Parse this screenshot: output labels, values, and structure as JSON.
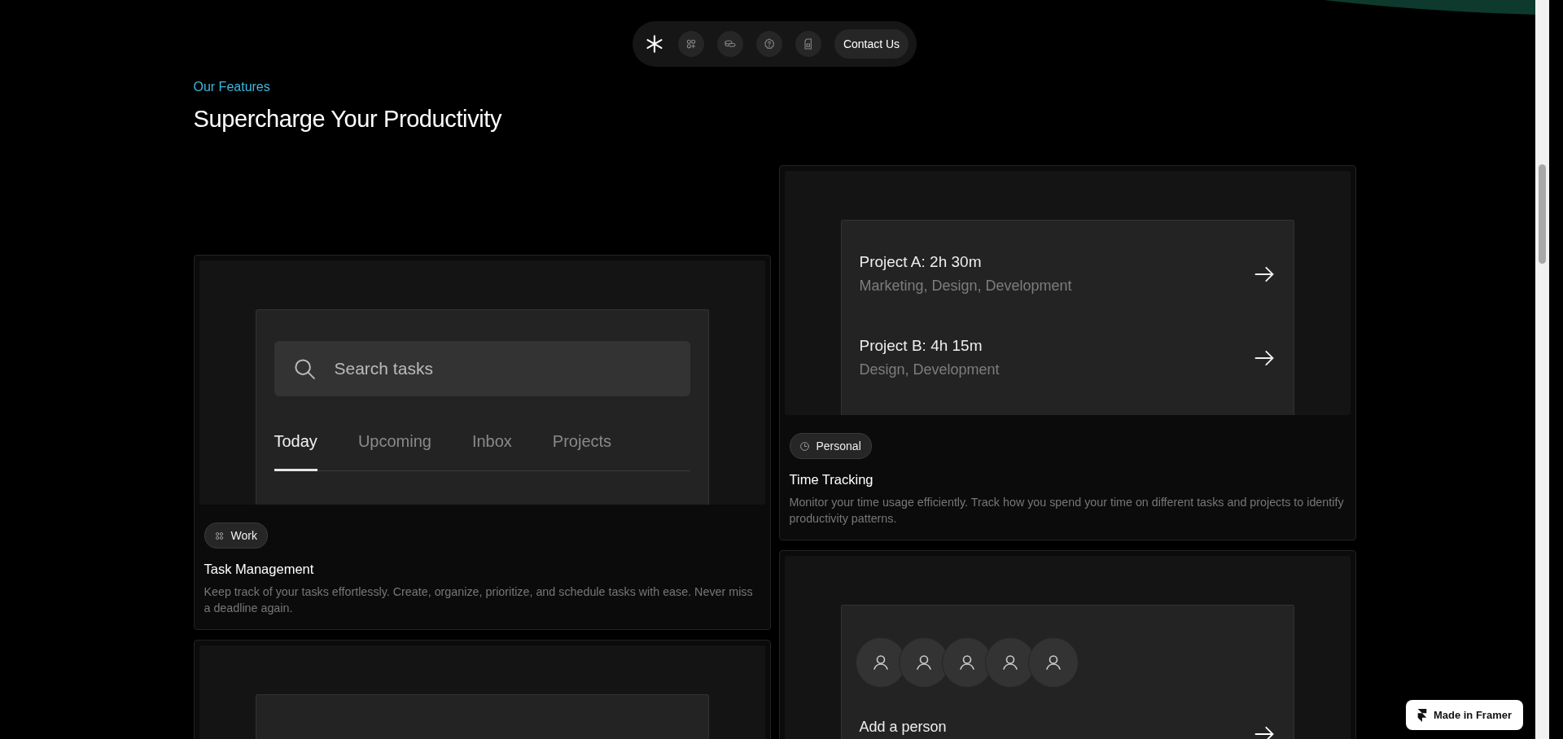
{
  "nav": {
    "button": "Contact Us"
  },
  "section": {
    "eyebrow": "Our Features",
    "title": "Supercharge Your Productivity"
  },
  "left_column": {
    "cards": [
      {
        "kind": "tasks",
        "search": {
          "placeholder": "Search tasks"
        },
        "tabs": [
          {
            "label": "Today",
            "selected": true
          },
          {
            "label": "Upcoming",
            "selected": false
          },
          {
            "label": "Inbox",
            "selected": false
          },
          {
            "label": "Projects",
            "selected": false
          }
        ],
        "tag": {
          "kind": "work",
          "label": "Work"
        },
        "title": "Task Management",
        "description": "Keep track of your tasks effortlessly. Create, organize, prioritize, and schedule tasks with ease. Never miss a deadline again."
      },
      {
        "kind": "empty"
      }
    ]
  },
  "right_column": {
    "cards": [
      {
        "kind": "projects",
        "projects": [
          {
            "name": "Project A: 2h 30m",
            "tags": "Marketing, Design, Development"
          },
          {
            "name": "Project B: 4h 15m",
            "tags": "Design, Development"
          }
        ],
        "tag": {
          "kind": "personal",
          "label": "Personal"
        },
        "title": "Time Tracking",
        "description": "Monitor your time usage efficiently. Track how you spend your time on different tasks and projects to identify productivity patterns."
      },
      {
        "kind": "people",
        "action": "Add a person"
      }
    ]
  },
  "badge": {
    "label": "Made in Framer"
  }
}
